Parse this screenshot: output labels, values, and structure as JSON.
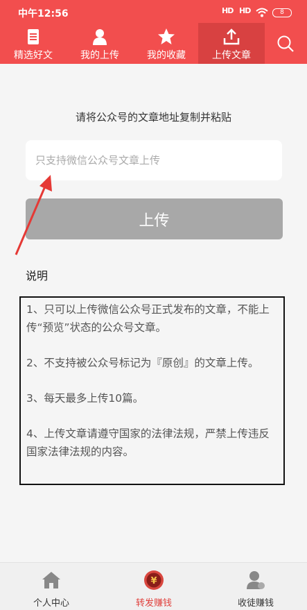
{
  "status_bar": {
    "time": "中午12:56",
    "signal1": "HD",
    "signal2": "HD",
    "battery": "8"
  },
  "top_nav": {
    "tabs": [
      {
        "label": "精选好文",
        "icon": "document-icon"
      },
      {
        "label": "我的上传",
        "icon": "person-icon"
      },
      {
        "label": "我的收藏",
        "icon": "star-icon"
      },
      {
        "label": "上传文章",
        "icon": "upload-icon"
      }
    ],
    "active_index": 3,
    "search_icon": "search-icon"
  },
  "main": {
    "hint": "请将公众号的文章地址复制并粘贴",
    "input_placeholder": "只支持微信公众号文章上传",
    "upload_button": "上传",
    "notes_title": "说明",
    "notes": [
      "1、只可以上传微信公众号正式发布的文章，不能上传“预览”状态的公众号文章。",
      "2、不支持被公众号标记为『原创』的文章上传。",
      "3、每天最多上传10篇。",
      "4、上传文章请遵守国家的法律法规，严禁上传违反国家法律法规的内容。"
    ]
  },
  "bottom_nav": {
    "tabs": [
      {
        "label": "个人中心",
        "icon": "home-icon"
      },
      {
        "label": "转发赚钱",
        "icon": "money-icon"
      },
      {
        "label": "收徒赚钱",
        "icon": "user-plus-icon"
      }
    ],
    "active_index": 1
  },
  "colors": {
    "brand": "#f24e4e",
    "active_tab": "#d84141",
    "button_disabled": "#a8a8a8",
    "arrow": "#e53935"
  }
}
